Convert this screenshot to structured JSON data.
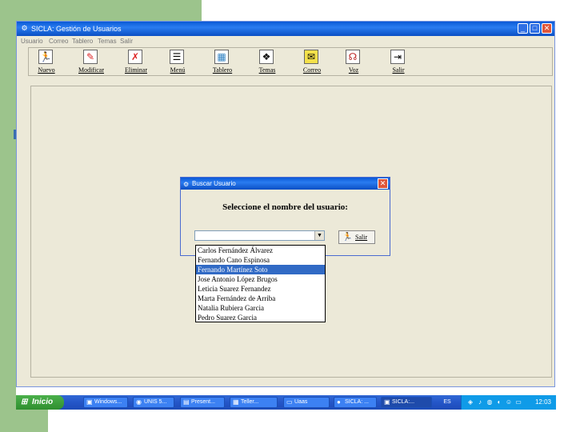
{
  "window": {
    "title": "SICLA: Gestión de Usuarios",
    "app_icon": "app-icon",
    "min_label": "_",
    "max_label": "□",
    "close_label": "✕"
  },
  "menu": [
    "Usuario",
    "Correo",
    "Tablero",
    "Temas",
    "Salir"
  ],
  "toolbar": [
    {
      "label": "Nuevo",
      "icon": "person-red-icon",
      "glyph": "🏃"
    },
    {
      "label": "Modificar",
      "icon": "person-edit-icon",
      "glyph": "✎"
    },
    {
      "label": "Eliminar",
      "icon": "person-delete-icon",
      "glyph": "✗"
    },
    {
      "label": "Menú",
      "icon": "menu-icon",
      "glyph": "☰"
    },
    {
      "label": "Tablero",
      "icon": "board-icon",
      "glyph": "▦"
    },
    {
      "label": "Temas",
      "icon": "themes-icon",
      "glyph": "❖"
    },
    {
      "label": "Correo",
      "icon": "mail-icon",
      "glyph": "✉"
    },
    {
      "label": "Voz",
      "icon": "voice-icon",
      "glyph": "☊"
    },
    {
      "label": "Salir",
      "icon": "exit-icon",
      "glyph": "⇥"
    }
  ],
  "dialog": {
    "title": "Buscar Usuario",
    "prompt": "Seleccione el nombre del usuario:",
    "close_label": "✕",
    "combo_value": "",
    "combo_arrow": "▼",
    "salir_label": "Salir",
    "salir_glyph": "🏃"
  },
  "users": [
    "Carlos Fernández Álvarez",
    "Fernando Cano Espinosa",
    "Fernando Martínez Soto",
    "Jose Antonio López Brugos",
    "Leticia Suarez Fernandez",
    "Marta Fernández de Arriba",
    "Natalia Rubiera Garcia",
    "Pedro Suarez Garcia"
  ],
  "selected_user_index": 2,
  "taskbar": {
    "start_label": "Inicio",
    "start_glyph": "⊞",
    "tasks": [
      {
        "label": "Windows...",
        "glyph": "▣"
      },
      {
        "label": "UNIS 5...",
        "glyph": "◉"
      },
      {
        "label": "Present...",
        "glyph": "▤"
      },
      {
        "label": "Teller...",
        "glyph": "▦"
      },
      {
        "label": "Uaas",
        "glyph": "▭"
      },
      {
        "label": "SICLA: ...",
        "glyph": "●"
      },
      {
        "label": "SICLA:...",
        "glyph": "▣"
      }
    ],
    "lang": "ES",
    "clock": "12:03"
  },
  "colors": {
    "title_blue": "#0a58d6",
    "selection_blue": "#316ac5",
    "slide_green": "#9cc48c",
    "start_green": "#3ba33b",
    "tray_blue": "#0f9be8"
  }
}
